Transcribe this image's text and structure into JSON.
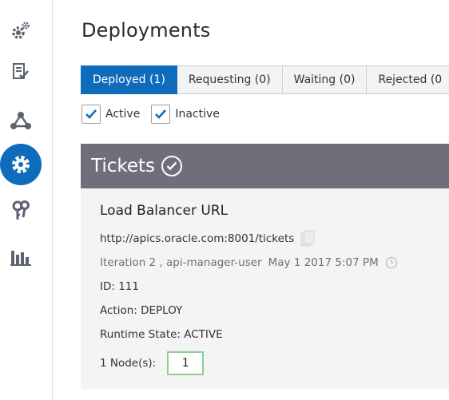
{
  "sidebar": {
    "items": [
      {
        "icon": "gears-icon",
        "active": false
      },
      {
        "icon": "checklist-icon",
        "active": false
      },
      {
        "icon": "network-icon",
        "active": false
      },
      {
        "icon": "gear-icon",
        "active": true
      },
      {
        "icon": "keys-icon",
        "active": false
      },
      {
        "icon": "bar-chart-icon",
        "active": false
      }
    ]
  },
  "page": {
    "title": "Deployments"
  },
  "tabs": [
    {
      "label": "Deployed (1)",
      "active": true
    },
    {
      "label": "Requesting (0)",
      "active": false
    },
    {
      "label": "Waiting (0)",
      "active": false
    },
    {
      "label": "Rejected (0",
      "active": false
    }
  ],
  "filters": [
    {
      "label": "Active",
      "checked": true
    },
    {
      "label": "Inactive",
      "checked": true
    }
  ],
  "card": {
    "title": "Tickets",
    "section_title": "Load Balancer URL",
    "url": "http://apics.oracle.com:8001/tickets",
    "iteration": "Iteration 2 , api-manager-user",
    "timestamp": "May 1 2017 5:07 PM",
    "id": "ID: 111",
    "action": "Action: DEPLOY",
    "runtime_state": "Runtime State: ACTIVE",
    "nodes_label": "1 Node(s):",
    "nodes_value": "1"
  },
  "colors": {
    "accent": "#0f6cbd",
    "card_header": "#6e6f7a",
    "node_border": "#8ed08e"
  }
}
